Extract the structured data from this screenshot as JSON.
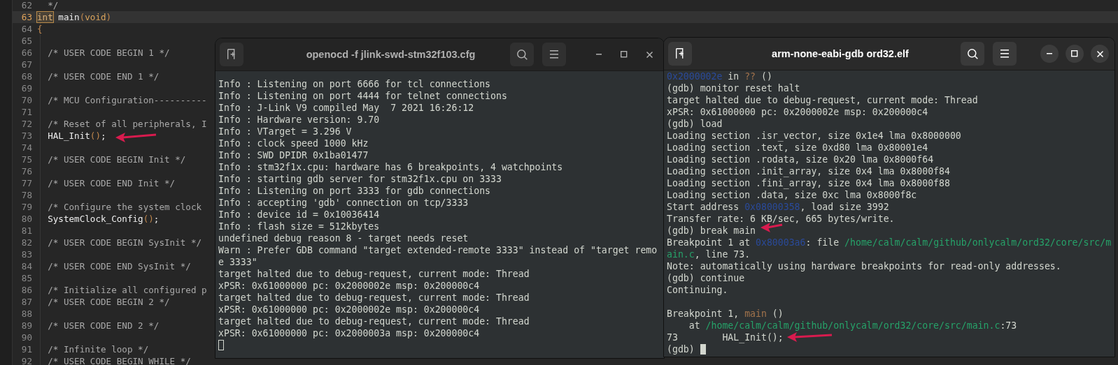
{
  "editor": {
    "lines": [
      {
        "number": "62",
        "current": false,
        "segments": [
          {
            "kind": "comment",
            "text": "  */"
          }
        ]
      },
      {
        "number": "63",
        "current": true,
        "segments": [
          {
            "kind": "match",
            "text": "int"
          },
          {
            "kind": "code",
            "text": " main"
          },
          {
            "kind": "punct",
            "text": "("
          },
          {
            "kind": "type",
            "text": "void"
          },
          {
            "kind": "punct",
            "text": ")"
          }
        ]
      },
      {
        "number": "64",
        "current": false,
        "segments": [
          {
            "kind": "punct",
            "text": "{"
          }
        ]
      },
      {
        "number": "65",
        "current": false
      },
      {
        "number": "66",
        "current": false,
        "segments": [
          {
            "kind": "comment",
            "text": "  /* USER CODE BEGIN 1 */"
          }
        ]
      },
      {
        "number": "67",
        "current": false
      },
      {
        "number": "68",
        "current": false,
        "segments": [
          {
            "kind": "comment",
            "text": "  /* USER CODE END 1 */"
          }
        ]
      },
      {
        "number": "69",
        "current": false
      },
      {
        "number": "70",
        "current": false,
        "segments": [
          {
            "kind": "comment",
            "text": "  /* MCU Configuration----------"
          }
        ]
      },
      {
        "number": "71",
        "current": false
      },
      {
        "number": "72",
        "current": false,
        "segments": [
          {
            "kind": "comment",
            "text": "  /* Reset of all peripherals, I"
          }
        ]
      },
      {
        "number": "73",
        "current": false,
        "segments": [
          {
            "kind": "code",
            "text": "  HAL_Init"
          },
          {
            "kind": "punct",
            "text": "()"
          },
          {
            "kind": "code",
            "text": ";"
          }
        ]
      },
      {
        "number": "74",
        "current": false
      },
      {
        "number": "75",
        "current": false,
        "segments": [
          {
            "kind": "comment",
            "text": "  /* USER CODE BEGIN Init */"
          }
        ]
      },
      {
        "number": "76",
        "current": false
      },
      {
        "number": "77",
        "current": false,
        "segments": [
          {
            "kind": "comment",
            "text": "  /* USER CODE END Init */"
          }
        ]
      },
      {
        "number": "78",
        "current": false
      },
      {
        "number": "79",
        "current": false,
        "segments": [
          {
            "kind": "comment",
            "text": "  /* Configure the system clock"
          }
        ]
      },
      {
        "number": "80",
        "current": false,
        "segments": [
          {
            "kind": "code",
            "text": "  SystemClock_Config"
          },
          {
            "kind": "punct",
            "text": "()"
          },
          {
            "kind": "code",
            "text": ";"
          }
        ]
      },
      {
        "number": "81",
        "current": false
      },
      {
        "number": "82",
        "current": false,
        "segments": [
          {
            "kind": "comment",
            "text": "  /* USER CODE BEGIN SysInit */"
          }
        ]
      },
      {
        "number": "83",
        "current": false
      },
      {
        "number": "84",
        "current": false,
        "segments": [
          {
            "kind": "comment",
            "text": "  /* USER CODE END SysInit */"
          }
        ]
      },
      {
        "number": "85",
        "current": false
      },
      {
        "number": "86",
        "current": false,
        "segments": [
          {
            "kind": "comment",
            "text": "  /* Initialize all configured p"
          }
        ]
      },
      {
        "number": "87",
        "current": false,
        "segments": [
          {
            "kind": "comment",
            "text": "  /* USER CODE BEGIN 2 */"
          }
        ]
      },
      {
        "number": "88",
        "current": false
      },
      {
        "number": "89",
        "current": false,
        "segments": [
          {
            "kind": "comment",
            "text": "  /* USER CODE END 2 */"
          }
        ]
      },
      {
        "number": "90",
        "current": false
      },
      {
        "number": "91",
        "current": false,
        "segments": [
          {
            "kind": "comment",
            "text": "  /* Infinite loop */"
          }
        ]
      },
      {
        "number": "92",
        "current": false,
        "segments": [
          {
            "kind": "comment",
            "text": "  /* USER CODE BEGIN WHILE */"
          }
        ]
      }
    ]
  },
  "terminals": [
    {
      "title": "openocd -f jlink-swd-stm32f103.cfg",
      "focused": false,
      "lines": [
        [
          {
            "kind": "plain",
            "text": "Info : Listening on port 6666 for tcl connections"
          }
        ],
        [
          {
            "kind": "plain",
            "text": "Info : Listening on port 4444 for telnet connections"
          }
        ],
        [
          {
            "kind": "plain",
            "text": "Info : J-Link V9 compiled May  7 2021 16:26:12"
          }
        ],
        [
          {
            "kind": "plain",
            "text": "Info : Hardware version: 9.70"
          }
        ],
        [
          {
            "kind": "plain",
            "text": "Info : VTarget = 3.296 V"
          }
        ],
        [
          {
            "kind": "plain",
            "text": "Info : clock speed 1000 kHz"
          }
        ],
        [
          {
            "kind": "plain",
            "text": "Info : SWD DPIDR 0x1ba01477"
          }
        ],
        [
          {
            "kind": "plain",
            "text": "Info : stm32f1x.cpu: hardware has 6 breakpoints, 4 watchpoints"
          }
        ],
        [
          {
            "kind": "plain",
            "text": "Info : starting gdb server for stm32f1x.cpu on 3333"
          }
        ],
        [
          {
            "kind": "plain",
            "text": "Info : Listening on port 3333 for gdb connections"
          }
        ],
        [
          {
            "kind": "plain",
            "text": "Info : accepting 'gdb' connection on tcp/3333"
          }
        ],
        [
          {
            "kind": "plain",
            "text": "Info : device id = 0x10036414"
          }
        ],
        [
          {
            "kind": "plain",
            "text": "Info : flash size = 512kbytes"
          }
        ],
        [
          {
            "kind": "plain",
            "text": "undefined debug reason 8 - target needs reset"
          }
        ],
        [
          {
            "kind": "plain",
            "text": "Warn : Prefer GDB command \"target extended-remote 3333\" instead of \"target remo"
          }
        ],
        [
          {
            "kind": "plain",
            "text": "e 3333\""
          }
        ],
        [
          {
            "kind": "plain",
            "text": "target halted due to debug-request, current mode: Thread"
          }
        ],
        [
          {
            "kind": "plain",
            "text": "xPSR: 0x61000000 pc: 0x2000002e msp: 0x200000c4"
          }
        ],
        [
          {
            "kind": "plain",
            "text": "target halted due to debug-request, current mode: Thread"
          }
        ],
        [
          {
            "kind": "plain",
            "text": "xPSR: 0x61000000 pc: 0x2000002e msp: 0x200000c4"
          }
        ],
        [
          {
            "kind": "plain",
            "text": "target halted due to debug-request, current mode: Thread"
          }
        ],
        [
          {
            "kind": "plain",
            "text": "xPSR: 0x61000000 pc: 0x2000003a msp: 0x200000c4"
          }
        ],
        {
          "kind": "blank"
        }
      ]
    },
    {
      "title": "arm-none-eabi-gdb ord32.elf",
      "focused": true,
      "lines": [
        [
          {
            "kind": "address",
            "text": "0x2000002e"
          },
          {
            "kind": "plain",
            "text": " in "
          },
          {
            "kind": "func",
            "text": "??"
          },
          {
            "kind": "plain",
            "text": " ()"
          }
        ],
        [
          {
            "kind": "plain",
            "text": "(gdb) monitor reset halt"
          }
        ],
        [
          {
            "kind": "plain",
            "text": "target halted due to debug-request, current mode: Thread"
          }
        ],
        [
          {
            "kind": "plain",
            "text": "xPSR: 0x61000000 pc: 0x2000002e msp: 0x200000c4"
          }
        ],
        [
          {
            "kind": "plain",
            "text": "(gdb) load"
          }
        ],
        [
          {
            "kind": "plain",
            "text": "Loading section .isr_vector, size 0x1e4 lma 0x8000000"
          }
        ],
        [
          {
            "kind": "plain",
            "text": "Loading section .text, size 0xd80 lma 0x80001e4"
          }
        ],
        [
          {
            "kind": "plain",
            "text": "Loading section .rodata, size 0x20 lma 0x8000f64"
          }
        ],
        [
          {
            "kind": "plain",
            "text": "Loading section .init_array, size 0x4 lma 0x8000f84"
          }
        ],
        [
          {
            "kind": "plain",
            "text": "Loading section .fini_array, size 0x4 lma 0x8000f88"
          }
        ],
        [
          {
            "kind": "plain",
            "text": "Loading section .data, size 0xc lma 0x8000f8c"
          }
        ],
        [
          {
            "kind": "plain",
            "text": "Start address "
          },
          {
            "kind": "address",
            "text": "0x08000358"
          },
          {
            "kind": "plain",
            "text": ", load size 3992"
          }
        ],
        [
          {
            "kind": "plain",
            "text": "Transfer rate: 6 KB/sec, 665 bytes/write."
          }
        ],
        [
          {
            "kind": "plain",
            "text": "(gdb) break main"
          }
        ],
        [
          {
            "kind": "plain",
            "text": "Breakpoint 1 at "
          },
          {
            "kind": "address",
            "text": "0x80003a6"
          },
          {
            "kind": "plain",
            "text": ": file "
          },
          {
            "kind": "path",
            "text": "/home/calm/calm/github/onlycalm/ord32/core/src/m"
          }
        ],
        [
          {
            "kind": "path",
            "text": "ain.c"
          },
          {
            "kind": "plain",
            "text": ", line 73."
          }
        ],
        [
          {
            "kind": "plain",
            "text": "Note: automatically using hardware breakpoints for read-only addresses."
          }
        ],
        [
          {
            "kind": "plain",
            "text": "(gdb) continue"
          }
        ],
        [
          {
            "kind": "plain",
            "text": "Continuing."
          }
        ],
        {
          "kind": "blank"
        },
        [
          {
            "kind": "plain",
            "text": "Breakpoint 1, "
          },
          {
            "kind": "func",
            "text": "main"
          },
          {
            "kind": "plain",
            "text": " ()"
          }
        ],
        [
          {
            "kind": "plain",
            "text": "    at "
          },
          {
            "kind": "path",
            "text": "/home/calm/calm/github/onlycalm/ord32/core/src/main.c"
          },
          {
            "kind": "plain",
            "text": ":73"
          }
        ],
        [
          {
            "kind": "plain",
            "text": "73        HAL_Init();"
          }
        ],
        [
          {
            "kind": "plain",
            "text": "(gdb) "
          }
        ]
      ]
    }
  ]
}
